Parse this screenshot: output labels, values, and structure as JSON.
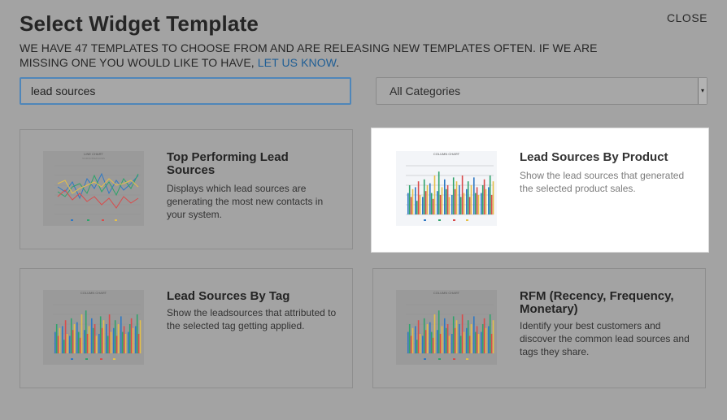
{
  "header": {
    "title": "Select Widget Template",
    "close_label": "CLOSE",
    "subtitle_text": "WE HAVE 47 TEMPLATES TO CHOOSE FROM AND ARE RELEASING NEW TEMPLATES OFTEN. IF WE ARE MISSING ONE YOU WOULD LIKE TO HAVE, ",
    "subtitle_link": "LET US KNOW",
    "subtitle_end": "."
  },
  "filters": {
    "search_value": "lead sources",
    "category_selected": "All Categories"
  },
  "templates": [
    {
      "title": "Top Performing Lead Sources",
      "description": "Displays which lead sources are generating the most new contacts in your system.",
      "thumbnail": "line-chart",
      "highlighted": false
    },
    {
      "title": "Lead Sources By Product",
      "description": "Show the lead sources that generated the selected product sales.",
      "thumbnail": "column-chart",
      "highlighted": true
    },
    {
      "title": "Lead Sources By Tag",
      "description": "Show the leadsources that attributed to the selected tag getting applied.",
      "thumbnail": "column-chart",
      "highlighted": false
    },
    {
      "title": "RFM (Recency, Frequency, Monetary)",
      "description": "Identify your best customers and discover the common lead sources and tags they share.",
      "thumbnail": "column-chart",
      "highlighted": false
    }
  ],
  "colors": {
    "link": "#1f5e95",
    "search_border": "#4f86b9",
    "series": [
      "#2f78c4",
      "#2fa36b",
      "#d94c4c",
      "#e5c04a"
    ]
  }
}
